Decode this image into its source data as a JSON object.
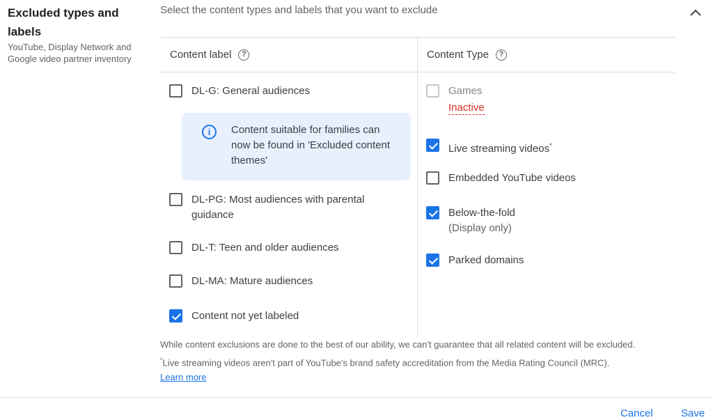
{
  "section": {
    "title": "Excluded types and labels",
    "subtitle": "YouTube, Display Network and Google video partner inventory"
  },
  "instructions": "Select the content types and labels that you want to exclude",
  "columns": {
    "content_label": "Content label",
    "content_type": "Content Type",
    "help_glyph": "?"
  },
  "content_labels": [
    {
      "label": "DL-G: General audiences",
      "checked": false
    },
    {
      "label": "DL-PG: Most audiences with parental guidance",
      "checked": false
    },
    {
      "label": "DL-T: Teen and older audiences",
      "checked": false
    },
    {
      "label": "DL-MA: Mature audiences",
      "checked": false
    },
    {
      "label": "Content not yet labeled",
      "checked": true
    }
  ],
  "info_box": {
    "icon_glyph": "i",
    "text": "Content suitable for families can now be found in 'Excluded content themes'"
  },
  "content_types": [
    {
      "label": "Games",
      "checked": false,
      "disabled": true,
      "status": "Inactive"
    },
    {
      "label": "Live streaming videos",
      "sup": "*",
      "checked": true
    },
    {
      "label": "Embedded YouTube videos",
      "checked": false
    },
    {
      "label": "Below-the-fold",
      "sub": "(Display only)",
      "checked": true
    },
    {
      "label": "Parked domains",
      "checked": true
    }
  ],
  "notes": {
    "line1": "While content exclusions are done to the best of our ability, we can't guarantee that all related content will be excluded.",
    "line2_sup": "*",
    "line2": "Live streaming videos aren't part of YouTube's brand safety accreditation from the Media Rating Council (MRC).",
    "learn_more": "Learn more"
  },
  "buttons": {
    "cancel": "Cancel",
    "save": "Save"
  },
  "colors": {
    "accent": "#1a73e8",
    "error": "#d93025",
    "info_bg": "#e8f0fe"
  },
  "icons": {
    "collapse": "chevron-up-icon",
    "help": "help-icon",
    "info": "info-icon"
  }
}
